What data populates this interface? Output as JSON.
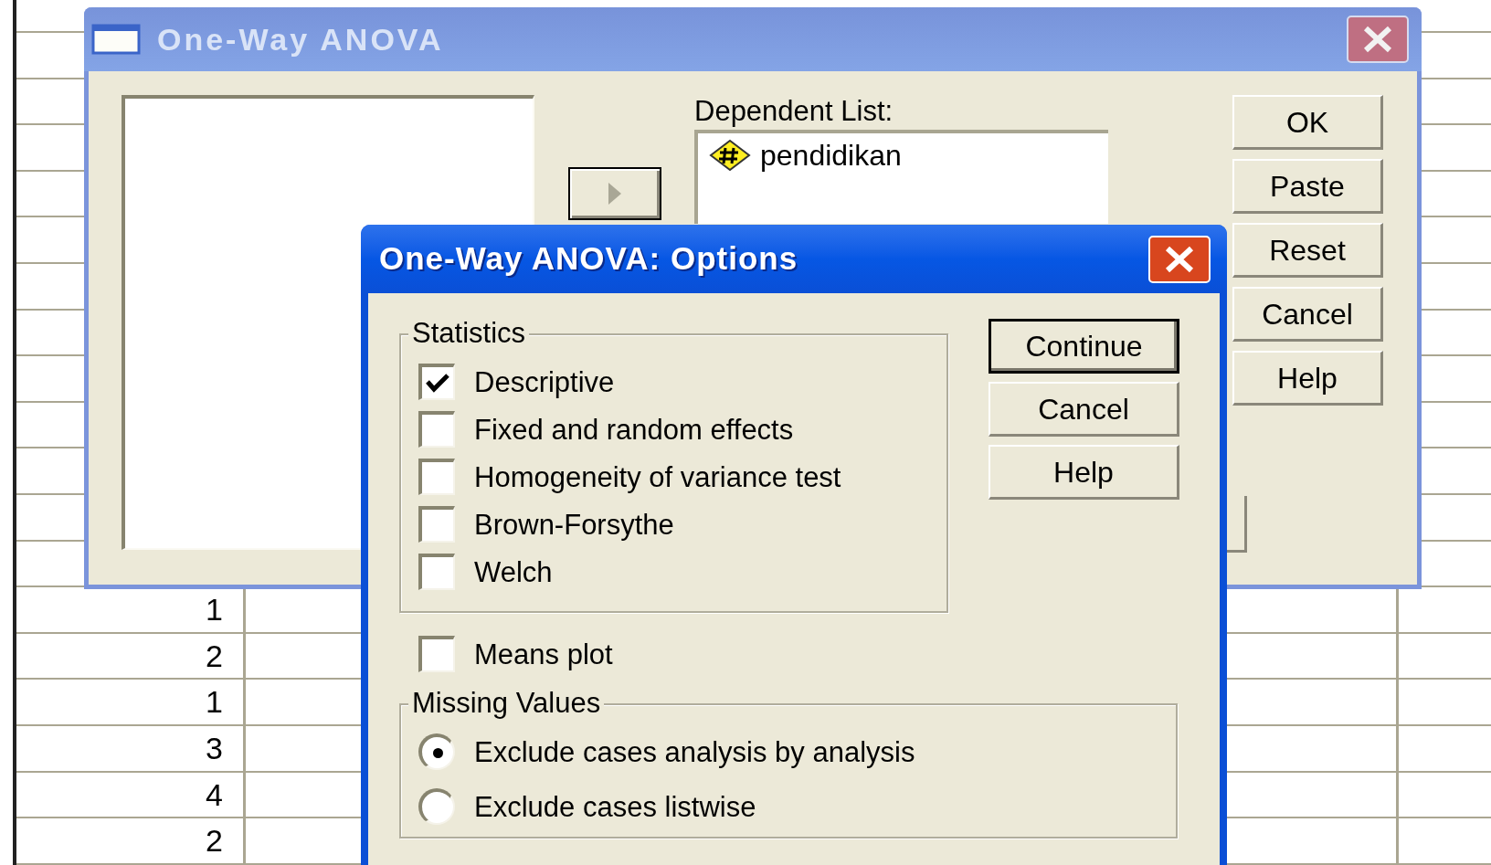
{
  "spreadsheet": {
    "rows": [
      {
        "column_1": "1"
      },
      {
        "column_1": "2"
      },
      {
        "column_1": "1"
      },
      {
        "column_1": "3"
      },
      {
        "column_1": "4"
      },
      {
        "column_1": "2"
      }
    ]
  },
  "main_dialog": {
    "title": "One-Way ANOVA",
    "active": false,
    "dependent_list": {
      "label": "Dependent List:",
      "items": [
        {
          "name": "pendidikan",
          "kind": "scale"
        }
      ]
    },
    "buttons": [
      "OK",
      "Paste",
      "Reset",
      "Cancel",
      "Help"
    ]
  },
  "options_dialog": {
    "title": "One-Way ANOVA: Options",
    "active": true,
    "statistics": {
      "label": "Statistics",
      "options": [
        {
          "label": "Descriptive",
          "checked": true
        },
        {
          "label": "Fixed and random effects",
          "checked": false
        },
        {
          "label": "Homogeneity of variance test",
          "checked": false
        },
        {
          "label": "Brown-Forsythe",
          "checked": false
        },
        {
          "label": "Welch",
          "checked": false
        }
      ]
    },
    "means_plot": {
      "label": "Means plot",
      "checked": false
    },
    "missing_values": {
      "label": "Missing Values",
      "options": [
        {
          "label": "Exclude cases analysis by analysis",
          "selected": true
        },
        {
          "label": "Exclude cases listwise",
          "selected": false
        }
      ]
    },
    "buttons": [
      {
        "label": "Continue",
        "default": true
      },
      {
        "label": "Cancel",
        "default": false
      },
      {
        "label": "Help",
        "default": false
      }
    ]
  }
}
